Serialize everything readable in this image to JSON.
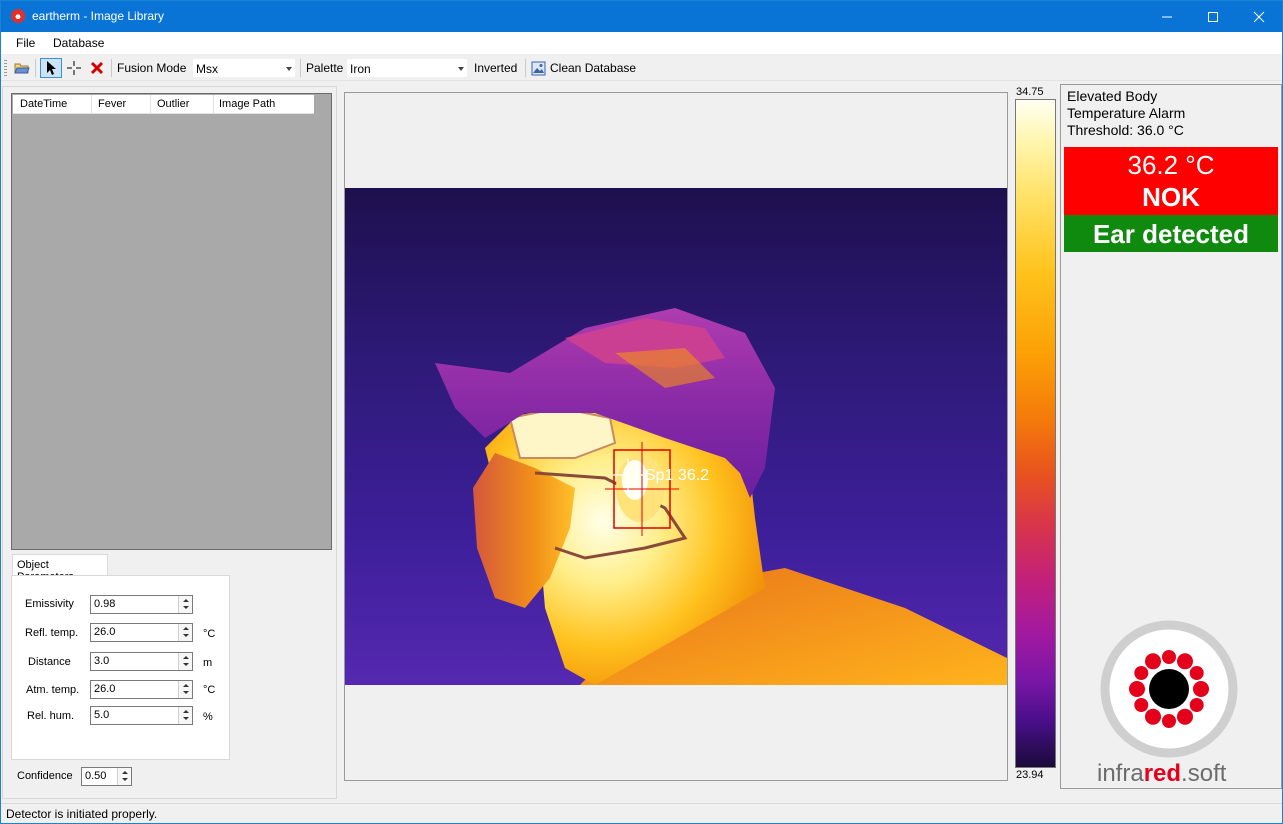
{
  "window": {
    "title": "eartherm - Image Library"
  },
  "menu": {
    "items": [
      "File",
      "Database"
    ]
  },
  "toolbar": {
    "fusion_label": "Fusion Mode",
    "fusion_value": "Msx",
    "palette_label": "Palette",
    "palette_value": "Iron",
    "inverted_label": "Inverted",
    "clean_label": "Clean Database",
    "icons": [
      "open-folder-icon",
      "pointer-icon",
      "crosshair-icon",
      "delete-icon",
      "database-clean-icon"
    ]
  },
  "table": {
    "columns": [
      "DateTime",
      "Fever",
      "Outlier",
      "Image Path"
    ],
    "rows": []
  },
  "object_parameters": {
    "tab_label": "Object Parameters",
    "emissivity": {
      "label": "Emissivity",
      "value": "0.98",
      "unit": ""
    },
    "refl_temp": {
      "label": "Refl. temp.",
      "value": "26.0",
      "unit": "°C"
    },
    "distance": {
      "label": "Distance",
      "value": "3.0",
      "unit": "m"
    },
    "atm_temp": {
      "label": "Atm. temp.",
      "value": "26.0",
      "unit": "°C"
    },
    "rel_hum": {
      "label": "Rel. hum.",
      "value": "5.0",
      "unit": "%"
    }
  },
  "confidence": {
    "label": "Confidence",
    "value": "0.50"
  },
  "image": {
    "spot_label": "Sp1 36.2"
  },
  "colorbar": {
    "max": "34.75",
    "min": "23.94",
    "palette": "Iron"
  },
  "alarm": {
    "line1": "Elevated Body",
    "line2": "Temperature Alarm",
    "threshold": "Threshold: 36.0  °C",
    "temperature": "36.2  °C",
    "status": "NOK",
    "detection": "Ear detected",
    "colors": {
      "nok": "#ff0000",
      "detected": "#0f8a0f"
    }
  },
  "logo": {
    "text_a": "infra",
    "text_b": "red",
    "text_c": ".soft"
  },
  "status": {
    "text": "Detector is initiated properly."
  }
}
